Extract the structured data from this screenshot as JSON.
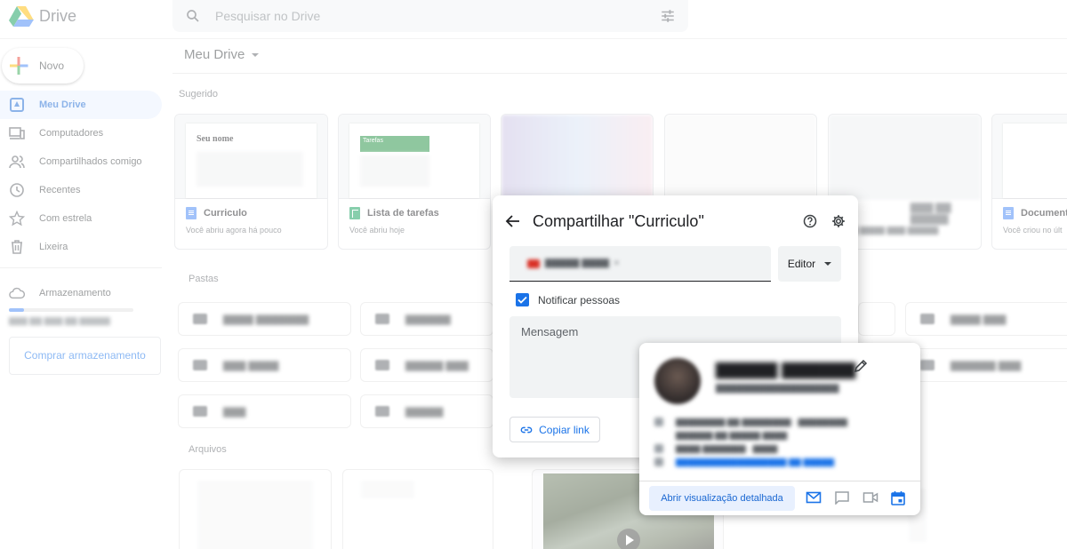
{
  "app": {
    "name": "Drive"
  },
  "search": {
    "placeholder": "Pesquisar no Drive"
  },
  "new_button": {
    "label": "Novo"
  },
  "sidebar": {
    "items": [
      {
        "label": "Meu Drive",
        "icon": "my-drive-icon",
        "active": true
      },
      {
        "label": "Computadores",
        "icon": "computers-icon"
      },
      {
        "label": "Compartilhados comigo",
        "icon": "shared-icon"
      },
      {
        "label": "Recentes",
        "icon": "clock-icon"
      },
      {
        "label": "Com estrela",
        "icon": "star-icon"
      },
      {
        "label": "Lixeira",
        "icon": "trash-icon"
      }
    ],
    "storage_label": "Armazenamento",
    "buy_storage": "Comprar armazenamento"
  },
  "breadcrumb": {
    "title": "Meu Drive"
  },
  "sections": {
    "suggested": "Sugerido",
    "folders": "Pastas",
    "files": "Arquivos"
  },
  "suggested_cards": [
    {
      "name": "Curriculo",
      "sub": "Você abriu agora há pouco",
      "type": "doc",
      "thumb_heading": "Seu nome"
    },
    {
      "name": "Lista de tarefas",
      "sub": "Você abriu hoje",
      "type": "sheet",
      "thumb_heading": "Tarefas"
    },
    {
      "name": "Document",
      "sub": "Você criou no últ",
      "type": "doc"
    }
  ],
  "share_dialog": {
    "title": "Compartilhar \"Curriculo\"",
    "role": "Editor",
    "notify_label": "Notificar pessoas",
    "notify_checked": true,
    "message_placeholder": "Mensagem",
    "copy_link": "Copiar link"
  },
  "profile_card": {
    "detail_button": "Abrir visualização detalhada"
  },
  "colors": {
    "accent": "#1a73e8",
    "active_bg": "#e8f0fe"
  }
}
